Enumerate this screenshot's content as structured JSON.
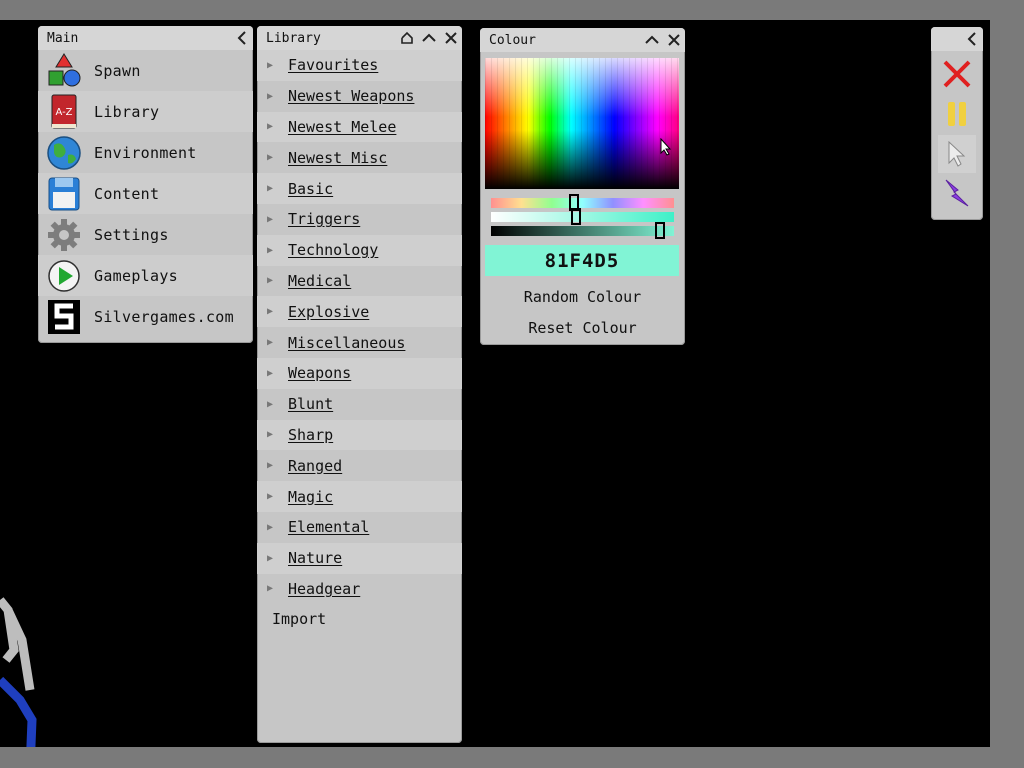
{
  "main_panel": {
    "title": "Main",
    "items": [
      {
        "label": "Spawn",
        "icon": "shapes-icon"
      },
      {
        "label": "Library",
        "icon": "book-icon"
      },
      {
        "label": "Environment",
        "icon": "globe-icon"
      },
      {
        "label": "Content",
        "icon": "floppy-disk-icon"
      },
      {
        "label": "Settings",
        "icon": "gear-icon"
      },
      {
        "label": "Gameplays",
        "icon": "play-icon"
      },
      {
        "label": "Silvergames.com",
        "icon": "silvergames-logo-icon"
      }
    ],
    "book_icon_text": "A-Z"
  },
  "library_panel": {
    "title": "Library",
    "items": [
      "Favourites",
      "Newest Weapons",
      "Newest Melee",
      "Newest Misc",
      "Basic",
      "Triggers",
      "Technology",
      "Medical",
      "Explosive",
      "Miscellaneous",
      "Weapons",
      "Blunt",
      "Sharp",
      "Ranged",
      "Magic",
      "Elemental",
      "Nature",
      "Headgear"
    ],
    "import_label": "Import"
  },
  "colour_panel": {
    "title": "Colour",
    "hex_value": "81F4D5",
    "hex_color": "#81F4D5",
    "random_label": "Random Colour",
    "reset_label": "Reset Colour",
    "hue_position": 0.45,
    "saturation_position": 0.46,
    "value_position": 0.95
  },
  "tool_panel": {
    "tools": [
      {
        "icon": "close-x-icon",
        "color": "#e02020"
      },
      {
        "icon": "pause-icon",
        "color": "#f0d040"
      },
      {
        "icon": "pointer-icon",
        "color": "#e8e8e8"
      },
      {
        "icon": "lightning-icon",
        "color": "#8a3ee0"
      }
    ]
  },
  "colors": {
    "panel_bg": "#c6c6c6",
    "viewport_bg": "#000000",
    "frame_bg": "#7a7a7a"
  }
}
